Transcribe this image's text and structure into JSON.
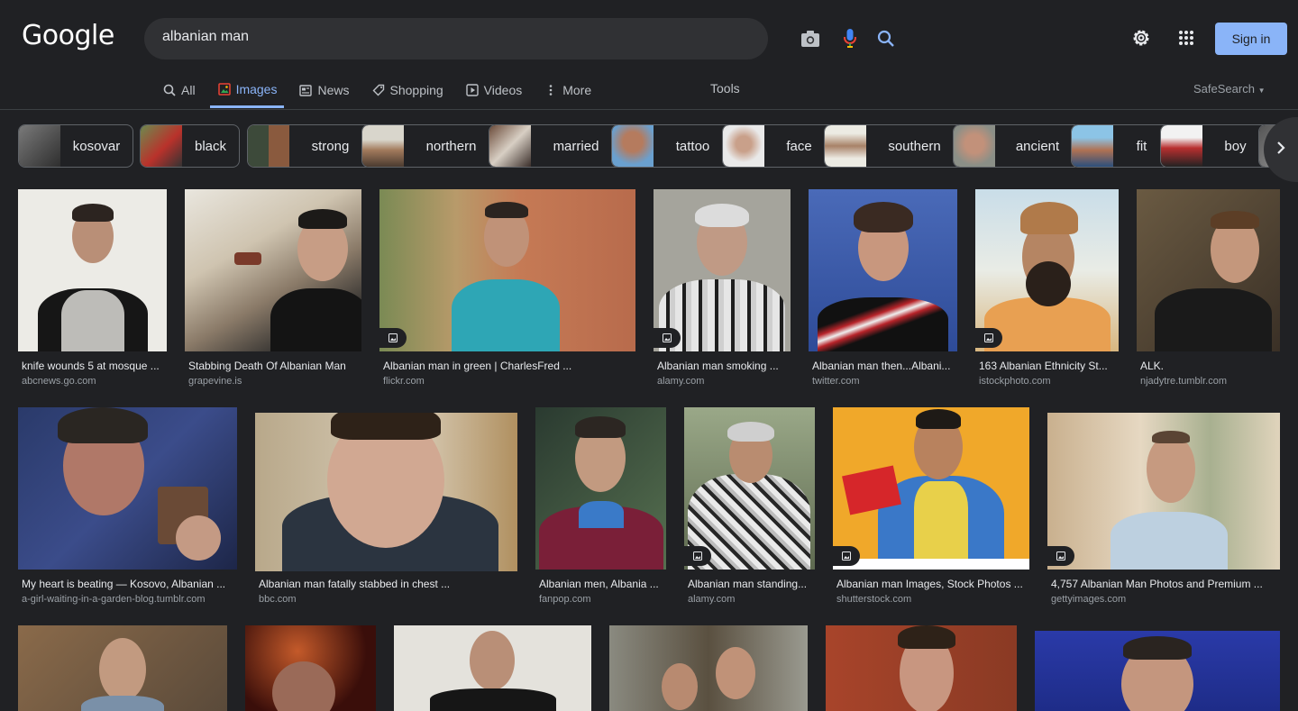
{
  "logo": "Google",
  "search": {
    "value": "albanian man"
  },
  "header": {
    "signin_label": "Sign in"
  },
  "tabs": [
    {
      "label": "All",
      "icon": "search-icon"
    },
    {
      "label": "Images",
      "icon": "image-icon",
      "active": true
    },
    {
      "label": "News",
      "icon": "news-icon"
    },
    {
      "label": "Shopping",
      "icon": "tag-icon"
    },
    {
      "label": "Videos",
      "icon": "play-icon"
    },
    {
      "label": "More",
      "icon": "more-vert-icon"
    }
  ],
  "tools_label": "Tools",
  "safesearch_label": "SafeSearch",
  "chips": [
    "kosovar",
    "black",
    "strong",
    "northern",
    "married",
    "tattoo",
    "face",
    "southern",
    "ancient",
    "fit",
    "boy"
  ],
  "results": [
    {
      "caption": "knife wounds 5 at mosque ...",
      "source": "abcnews.go.com"
    },
    {
      "caption": "Stabbing Death Of Albanian Man",
      "source": "grapevine.is"
    },
    {
      "caption": "Albanian man in green | CharlesFred ...",
      "source": "flickr.com"
    },
    {
      "caption": "Albanian man smoking ...",
      "source": "alamy.com"
    },
    {
      "caption": "Albanian man then...Albani...",
      "source": "twitter.com"
    },
    {
      "caption": "163 Albanian Ethnicity St...",
      "source": "istockphoto.com"
    },
    {
      "caption": "ALK.",
      "source": "njadytre.tumblr.com"
    },
    {
      "caption": "My heart is beating — Kosovo, Albanian ...",
      "source": "a-girl-waiting-in-a-garden-blog.tumblr.com"
    },
    {
      "caption": "Albanian man fatally stabbed in chest ...",
      "source": "bbc.com"
    },
    {
      "caption": "Albanian men, Albania ...",
      "source": "fanpop.com"
    },
    {
      "caption": "Albanian man standing...",
      "source": "alamy.com"
    },
    {
      "caption": "Albanian man Images, Stock Photos ...",
      "source": "shutterstock.com"
    },
    {
      "caption": "4,757 Albanian Man Photos and Premium ...",
      "source": "gettyimages.com"
    }
  ],
  "colors": {
    "background": "#202124",
    "accent": "#8ab4f8",
    "chip_border": "#5f6368"
  }
}
